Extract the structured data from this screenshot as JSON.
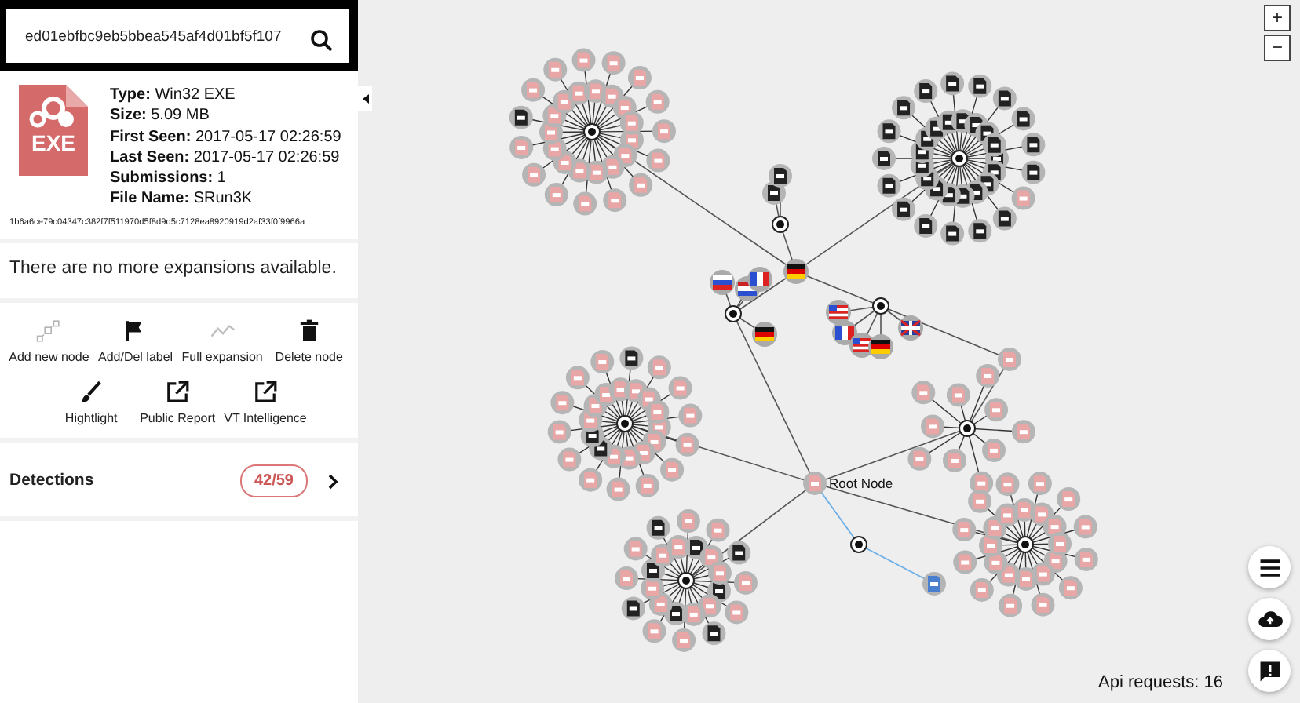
{
  "search": {
    "value": "ed01ebfbc9eb5bbea545af4d01bf5f107"
  },
  "file": {
    "icon_label": "EXE",
    "details": [
      "**Type:** Win32 EXE",
      "**Size:** 5.09 MB",
      "**First Seen:** 2017-05-17 02:26:59",
      "**Last Seen:** 2017-05-17 02:26:59",
      "**Submissions:** 1",
      "**File Name:** SRun3K"
    ],
    "hash": "1b6a6ce79c04347c382f7f511970d5f8d9d5c7128ea8920919d2af33f0f9966a"
  },
  "message": "There are no more expansions available.",
  "actions": [
    {
      "kind": "add",
      "label": "Add new node",
      "disabled": true
    },
    {
      "kind": "label",
      "label": "Add/Del label",
      "disabled": false
    },
    {
      "kind": "expand",
      "label": "Full expansion",
      "disabled": true
    },
    {
      "kind": "delete",
      "label": "Delete node",
      "disabled": false
    },
    {
      "kind": "highlight",
      "label": "Hightlight",
      "disabled": false
    },
    {
      "kind": "report",
      "label": "Public Report",
      "disabled": false
    },
    {
      "kind": "report",
      "label": "VT Intelligence",
      "disabled": false
    }
  ],
  "detections": {
    "label": "Detections",
    "count": "42/59"
  },
  "graph": {
    "root_label": "Root Node"
  },
  "zoom": [
    "+",
    "−"
  ],
  "api_requests": "Api requests: 16"
}
